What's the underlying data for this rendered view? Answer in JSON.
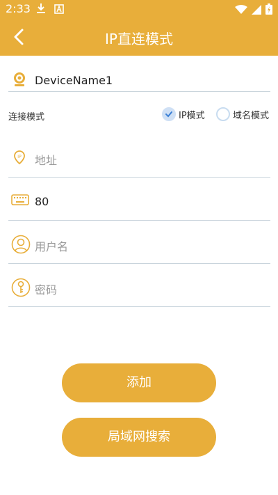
{
  "status_bar": {
    "time": "2:33",
    "icons": [
      "download-icon",
      "keyboard-a-icon",
      "wifi-icon",
      "signal-icon",
      "battery-charging-icon"
    ]
  },
  "header": {
    "title": "IP直连模式",
    "background": "#E8AE3A"
  },
  "form": {
    "device_name": {
      "value": "DeviceName1",
      "icon": "camera-icon"
    },
    "mode": {
      "label": "连接模式",
      "options": [
        {
          "label": "IP模式",
          "selected": true
        },
        {
          "label": "域名模式",
          "selected": false
        }
      ]
    },
    "address": {
      "value": "",
      "placeholder": "地址",
      "icon": "ip-pin-icon"
    },
    "port": {
      "value": "80",
      "icon": "keyboard-icon"
    },
    "username": {
      "value": "",
      "placeholder": "用户名",
      "icon": "user-icon"
    },
    "password": {
      "value": "",
      "placeholder": "密码",
      "icon": "key-icon"
    }
  },
  "buttons": {
    "add": "添加",
    "lan_search": "局域网搜索"
  }
}
